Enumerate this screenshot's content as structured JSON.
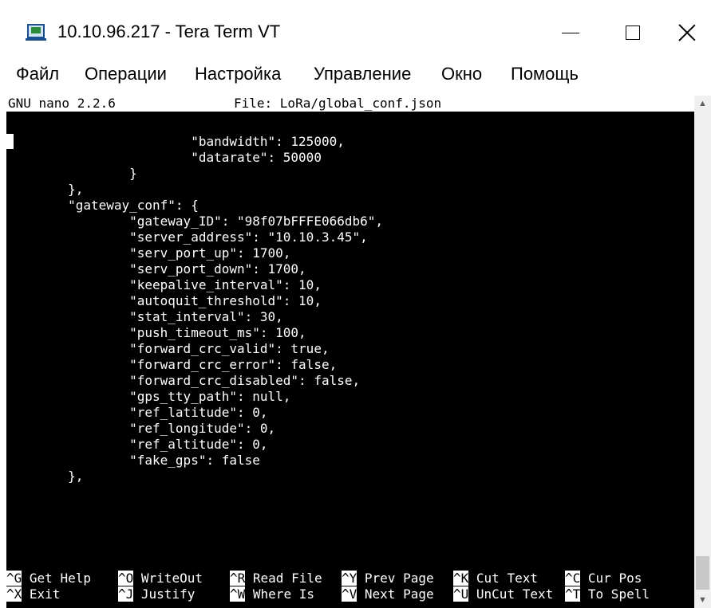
{
  "window": {
    "title": "10.10.96.217 - Tera Term VT",
    "icon": "teraterm-icon",
    "controls": {
      "minimize": "minimize-icon",
      "maximize": "maximize-icon",
      "close": "close-icon"
    }
  },
  "menu": {
    "items": [
      "Файл",
      "Операции",
      "Настройка",
      "Управление",
      "Окно",
      "Помощь"
    ]
  },
  "nano": {
    "version": "GNU nano 2.2.6",
    "file": "File: LoRa/global_conf.json"
  },
  "code_lines": [
    "                        \"bandwidth\": 125000,",
    "                        \"datarate\": 50000",
    "                }",
    "        },",
    "        \"gateway_conf\": {",
    "                \"gateway_ID\": \"98f07bFFFE066db6\",",
    "                \"server_address\": \"10.10.3.45\",",
    "                \"serv_port_up\": 1700,",
    "                \"serv_port_down\": 1700,",
    "                \"keepalive_interval\": 10,",
    "                \"autoquit_threshold\": 10,",
    "                \"stat_interval\": 30,",
    "                \"push_timeout_ms\": 100,",
    "                \"forward_crc_valid\": true,",
    "                \"forward_crc_error\": false,",
    "                \"forward_crc_disabled\": false,",
    "                \"gps_tty_path\": null,",
    "                \"ref_latitude\": 0,",
    "                \"ref_longitude\": 0,",
    "                \"ref_altitude\": 0,",
    "                \"fake_gps\": false",
    "        },"
  ],
  "shortcuts": {
    "row1": [
      {
        "key": "^G",
        "label": "Get Help"
      },
      {
        "key": "^O",
        "label": "WriteOut"
      },
      {
        "key": "^R",
        "label": "Read File"
      },
      {
        "key": "^Y",
        "label": "Prev Page"
      },
      {
        "key": "^K",
        "label": "Cut Text"
      },
      {
        "key": "^C",
        "label": "Cur Pos"
      }
    ],
    "row2": [
      {
        "key": "^X",
        "label": "Exit"
      },
      {
        "key": "^J",
        "label": "Justify"
      },
      {
        "key": "^W",
        "label": "Where Is"
      },
      {
        "key": "^V",
        "label": "Next Page"
      },
      {
        "key": "^U",
        "label": "UnCut Text"
      },
      {
        "key": "^T",
        "label": "To Spell"
      }
    ]
  },
  "colors": {
    "terminal_bg": "#000000",
    "terminal_fg": "#ffffff",
    "header_bg": "#ffffff"
  }
}
